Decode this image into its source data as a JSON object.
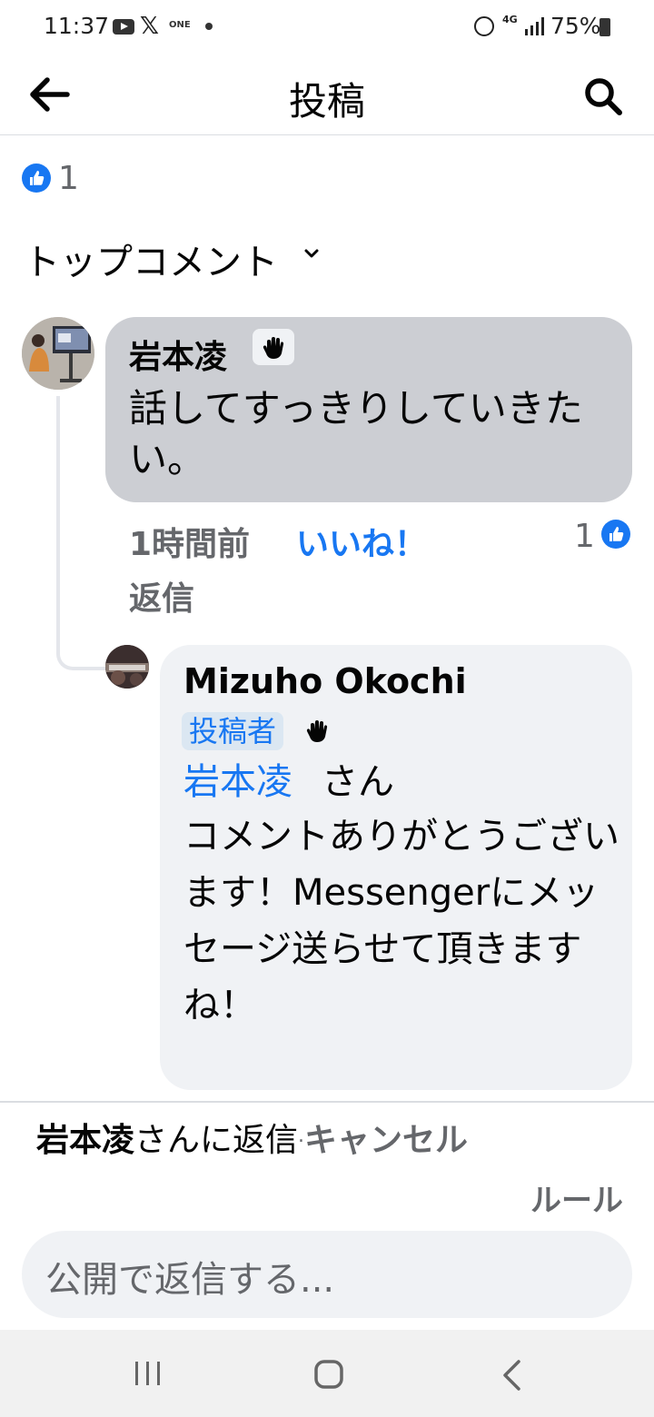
{
  "status_bar": {
    "time": "11:37",
    "x_logo": "𝕏",
    "app_label": "ONE",
    "network": "4G",
    "battery": "75%"
  },
  "header": {
    "title": "投稿",
    "back_icon": "arrow-left-icon",
    "search_icon": "search-icon"
  },
  "reactions": {
    "count": "1"
  },
  "sort": {
    "label": "トップコメント"
  },
  "comments": [
    {
      "author": "岩本凌",
      "text": "話してすっきりしていきたい。",
      "time": "1時間前",
      "like_label": "いいね！",
      "reply_label": "返信",
      "like_count": "1"
    },
    {
      "author": "Mizuho Okochi",
      "author_tag": "投稿者",
      "mention": "岩本凌",
      "mention_suffix": "さん",
      "text": "コメントありがとうございます！Messengerにメッセージ送らせて頂きますね！"
    }
  ],
  "reply_bar": {
    "reply_to_name": "岩本凌",
    "reply_to_suffix": "さんに返信",
    "separator": "·",
    "cancel_label": "キャンセル",
    "rules_label": "ルール",
    "input_placeholder": "公開で返信する..."
  },
  "colors": {
    "facebook_blue": "#1877f2",
    "bubble_gray": "#ccced3",
    "bubble_light": "#f0f2f5",
    "secondary_text": "#65676b"
  }
}
